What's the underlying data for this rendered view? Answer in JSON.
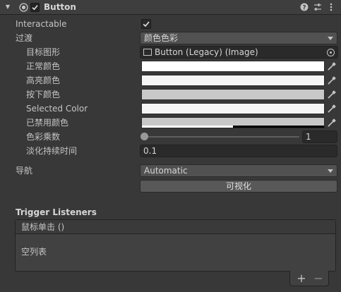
{
  "component": {
    "title": "Button",
    "enabled": true,
    "help_icon": "help-icon",
    "presets_icon": "presets-icon",
    "menu_icon": "kebab-menu-icon"
  },
  "fields": {
    "interactable": {
      "label": "Interactable",
      "checked": true
    },
    "transition": {
      "label": "过渡",
      "value": "颜色色彩"
    },
    "target_graphic": {
      "label": "目标图形",
      "value": "Button (Legacy) (Image)"
    },
    "normal_color": {
      "label": "正常颜色",
      "color": "#ffffff"
    },
    "highlighted_color": {
      "label": "高亮颜色",
      "color": "#f5f5f5"
    },
    "pressed_color": {
      "label": "按下颜色",
      "color": "#c8c8c8"
    },
    "selected_color": {
      "label": "Selected Color",
      "color": "#f5f5f5"
    },
    "disabled_color": {
      "label": "已禁用颜色",
      "color": "#c8c8c8",
      "alpha_fraction": 0.5
    },
    "color_multiplier": {
      "label": "色彩乘数",
      "value": "1",
      "slider_fraction": 0.0
    },
    "fade_duration": {
      "label": "淡化持续时间",
      "value": "0.1"
    },
    "navigation": {
      "label": "导航",
      "value": "Automatic"
    },
    "visualize": {
      "label": "可视化"
    }
  },
  "trigger_listeners": {
    "title": "Trigger Listeners",
    "list_header": "鼠标单击 ()",
    "empty_text": "空列表",
    "add_label": "+",
    "remove_label": "−"
  },
  "colors": {
    "panel_bg": "#383838",
    "header_bg": "#3e3e3e",
    "field_bg": "#2a2a2a",
    "button_bg": "#585858"
  }
}
